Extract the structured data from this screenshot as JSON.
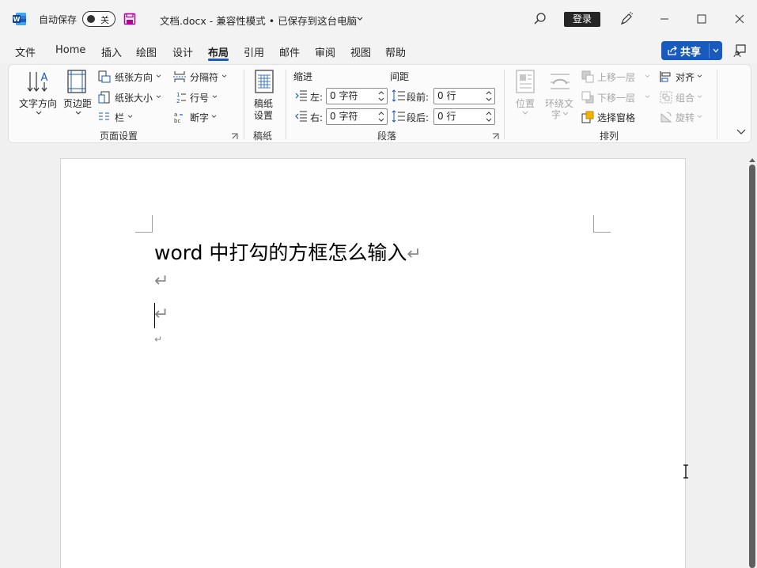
{
  "titlebar": {
    "autosave_label": "自动保存",
    "toggle_state": "关",
    "doc_title": "文档.docx  -  兼容性模式 • 已保存到这台电脑",
    "login_label": "登录"
  },
  "menu": {
    "tabs": [
      "文件",
      "Home",
      "插入",
      "绘图",
      "设计",
      "布局",
      "引用",
      "邮件",
      "审阅",
      "视图",
      "帮助"
    ],
    "active_tab": "布局",
    "share_label": "共享"
  },
  "ribbon": {
    "page_setup": {
      "text_direction": "文字方向",
      "margins": "页边距",
      "orientation": "纸张方向",
      "size": "纸张大小",
      "columns": "栏",
      "breaks": "分隔符",
      "line_numbers": "行号",
      "hyphenation": "断字",
      "group_label": "页面设置"
    },
    "manuscript": {
      "setup_line1": "稿纸",
      "setup_line2": "设置",
      "group_label": "稿纸"
    },
    "paragraph": {
      "indent_header": "缩进",
      "spacing_header": "间距",
      "left_label": "左:",
      "right_label": "右:",
      "before_label": "段前:",
      "after_label": "段后:",
      "left_value": "0 字符",
      "right_value": "0 字符",
      "before_value": "0 行",
      "after_value": "0 行",
      "group_label": "段落"
    },
    "arrange": {
      "position": "位置",
      "wrap_line1": "环绕文",
      "wrap_line2": "字",
      "bring_forward": "上移一层",
      "send_backward": "下移一层",
      "selection_pane": "选择窗格",
      "align": "对齐",
      "group": "组合",
      "rotate": "旋转",
      "group_label": "排列"
    }
  },
  "document": {
    "heading": "word 中打勾的方框怎么输入",
    "pilcrow": "↵"
  },
  "colors": {
    "accent": "#185abd",
    "login_bg": "#262626",
    "scroll_thumb": "#5f5f5f"
  }
}
